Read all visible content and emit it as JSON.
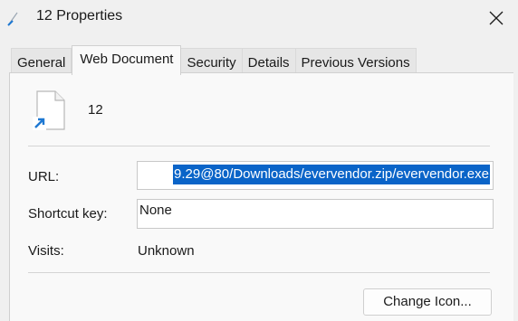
{
  "window": {
    "title": "12 Properties"
  },
  "tabs": [
    {
      "label": "General",
      "active": false
    },
    {
      "label": "Web Document",
      "active": true
    },
    {
      "label": "Security",
      "active": false
    },
    {
      "label": "Details",
      "active": false
    },
    {
      "label": "Previous Versions",
      "active": false
    }
  ],
  "file": {
    "name": "12",
    "icon": "shortcut-document-icon"
  },
  "fields": {
    "url_label": "URL:",
    "url_value": "9.29@80/Downloads/evervendor.zip/evervendor.exe",
    "shortcut_label": "Shortcut key:",
    "shortcut_value": "None",
    "visits_label": "Visits:",
    "visits_value": "Unknown"
  },
  "buttons": {
    "change_icon": "Change Icon..."
  },
  "colors": {
    "selection": "#0a64c8",
    "shortcut_arrow": "#1e78d2"
  }
}
